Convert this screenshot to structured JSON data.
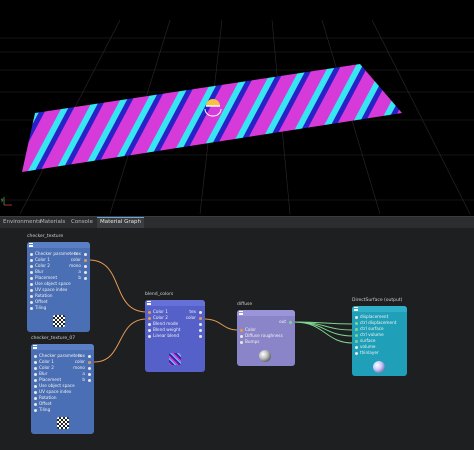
{
  "tabs": [
    {
      "label": "Environments"
    },
    {
      "label": "Materials"
    },
    {
      "label": "Console"
    },
    {
      "label": "Material Graph"
    }
  ],
  "active_tab": "Material Graph",
  "nodes": {
    "checker1": {
      "title": "checker_texture",
      "rows": [
        "Checker parameters",
        "Color 1",
        "Color 2",
        "Blur",
        "Placement",
        "Use object space",
        "UV space index",
        "Rotation",
        "Offset",
        "Tiling"
      ],
      "outputs": {
        "tex": "tex",
        "color": "color",
        "mono": "mono",
        "a": "a",
        "b": "b"
      }
    },
    "checker2": {
      "title": "checker_texture_07",
      "rows": [
        "Checker parameters",
        "Color 1",
        "Color 2",
        "Blur",
        "Placement",
        "Use object space",
        "UV space index",
        "Rotation",
        "Offset",
        "Tiling"
      ],
      "outputs": {
        "tex": "tex",
        "color": "color",
        "mono": "mono",
        "a": "a",
        "b": "b"
      }
    },
    "blend": {
      "title": "blend_colors",
      "rows": [
        "Color 1",
        "Color 2",
        "Blend mode",
        "Blend weight",
        "Linear blend"
      ],
      "outputs": {
        "tex": "tex",
        "color": "color"
      }
    },
    "diffuse": {
      "title": "diffuse",
      "rows": [
        "Color",
        "Diffuse roughness",
        "Bumps"
      ],
      "outputs": {
        "out": "out"
      }
    },
    "dsurface": {
      "title": "DirectSurface (output)",
      "rows": [
        "displacement",
        "ctrl displacement",
        "ctrl surface",
        "ctrl volume",
        "surface",
        "volume",
        "thinlayer"
      ]
    }
  },
  "colors": {
    "checker_header": "#4a6fb5",
    "blend_header": "#5560c8",
    "diffuse_header": "#8a85c8",
    "output_header": "#1fa0b8",
    "wire_color": "#e49a55",
    "wire_surface": "#7fd48f",
    "stripe_magenta": "#d63bd9",
    "stripe_cyan": "#36e6f0",
    "stripe_blue": "#2a20c8"
  },
  "icons": [
    "menu-icon",
    "checker-preview-icon",
    "sphere-preview-icon",
    "light-gizmo-icon",
    "axis-gizmo-icon"
  ]
}
